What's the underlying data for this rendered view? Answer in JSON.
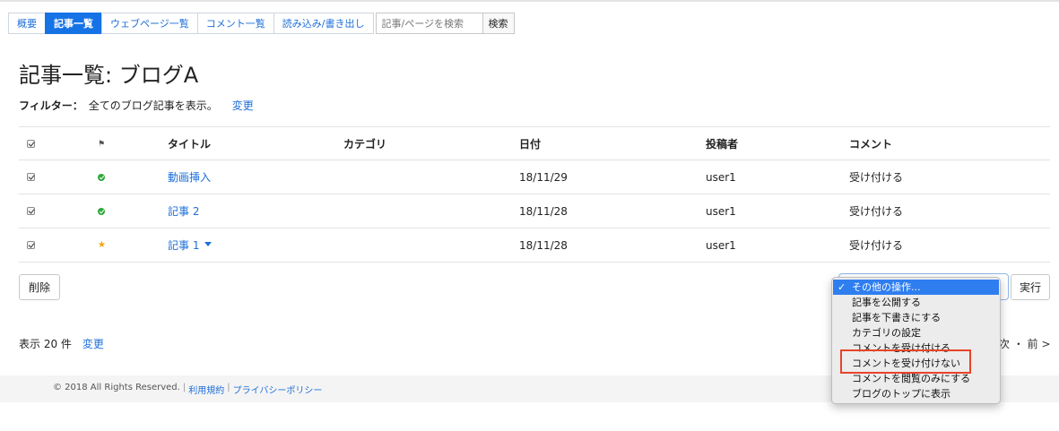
{
  "nav": {
    "tabs": [
      {
        "label": "概要",
        "active": false
      },
      {
        "label": "記事一覧",
        "active": true
      },
      {
        "label": "ウェブページ一覧",
        "active": false
      },
      {
        "label": "コメント一覧",
        "active": false
      },
      {
        "label": "読み込み/書き出し",
        "active": false
      }
    ],
    "search_placeholder": "記事/ページを検索",
    "search_button": "検索"
  },
  "page": {
    "title": "記事一覧: ブログA",
    "filter_label": "フィルター：",
    "filter_value": "全てのブログ記事を表示。",
    "filter_change": "変更"
  },
  "table": {
    "headers": {
      "title": "タイトル",
      "category": "カテゴリ",
      "date": "日付",
      "author": "投稿者",
      "comment": "コメント"
    },
    "rows": [
      {
        "status": "published",
        "title": "動画挿入",
        "category": "",
        "date": "18/11/29",
        "author": "user1",
        "comment": "受け付ける",
        "has_menu": false
      },
      {
        "status": "published",
        "title": "記事 2",
        "category": "",
        "date": "18/11/28",
        "author": "user1",
        "comment": "受け付ける",
        "has_menu": false
      },
      {
        "status": "starred",
        "title": "記事 1",
        "category": "",
        "date": "18/11/28",
        "author": "user1",
        "comment": "受け付ける",
        "has_menu": true
      }
    ]
  },
  "actions": {
    "delete": "削除",
    "run": "実行",
    "menu_items": [
      "その他の操作...",
      "記事を公開する",
      "記事を下書きにする",
      "カテゴリの設定",
      "コメントを受け付ける",
      "コメントを受け付けない",
      "コメントを閲覧のみにする",
      "ブログのトップに表示"
    ],
    "selected_index": 0
  },
  "pagination": {
    "per_page": "表示 20 件",
    "change": "変更",
    "pager": "次 ・ 前 >"
  },
  "footer": {
    "copyright": "© 2018 All Rights Reserved.",
    "separator": "|",
    "terms": "利用規約",
    "privacy": "プライバシーポリシー"
  },
  "colors": {
    "accent": "#1673e6",
    "link": "#1e6fd9",
    "published": "#2fa83c",
    "starred": "#f0a30a",
    "highlight": "#e8432a"
  }
}
